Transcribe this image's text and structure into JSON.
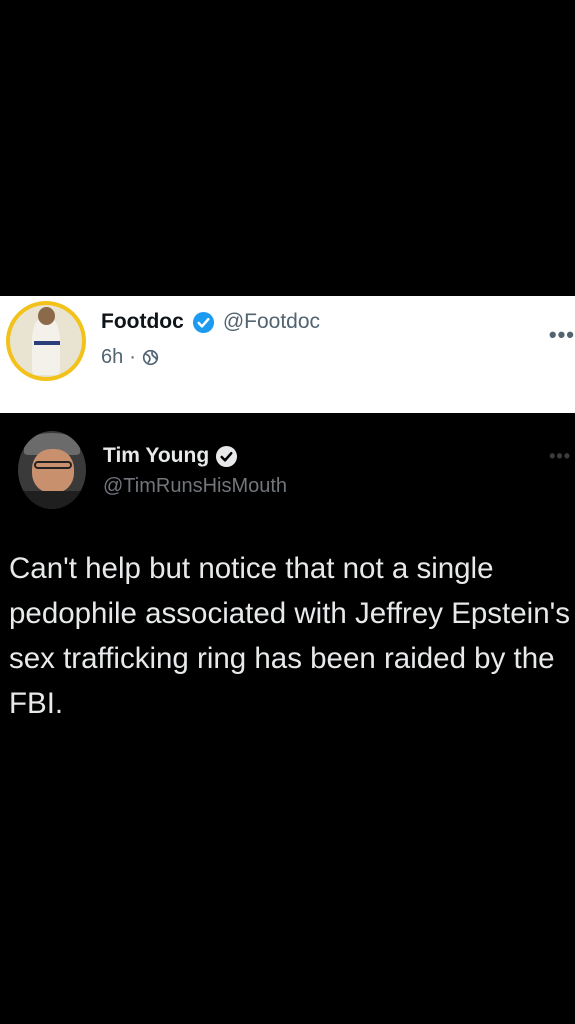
{
  "outer_post": {
    "name": "Footdoc",
    "handle": "@Footdoc",
    "time": "6h",
    "separator": "·",
    "icons": {
      "verified": "verified-badge-icon",
      "audience": "globe-icon",
      "more": "more-options-icon"
    },
    "more_label": "•••"
  },
  "quoted_post": {
    "name": "Tim Young",
    "handle": "@TimRunsHisMouth",
    "text": "Can't help but notice that not a single pedophile associated with Jeffrey Epstein's sex trafficking ring has been raided by the FBI.",
    "icons": {
      "verified": "verified-badge-icon",
      "more": "more-options-icon"
    },
    "more_label": "•••"
  },
  "colors": {
    "background": "#000000",
    "header_bg": "#ffffff",
    "verified_blue": "#1d9bf0",
    "avatar_ring": "#f2c21b"
  }
}
